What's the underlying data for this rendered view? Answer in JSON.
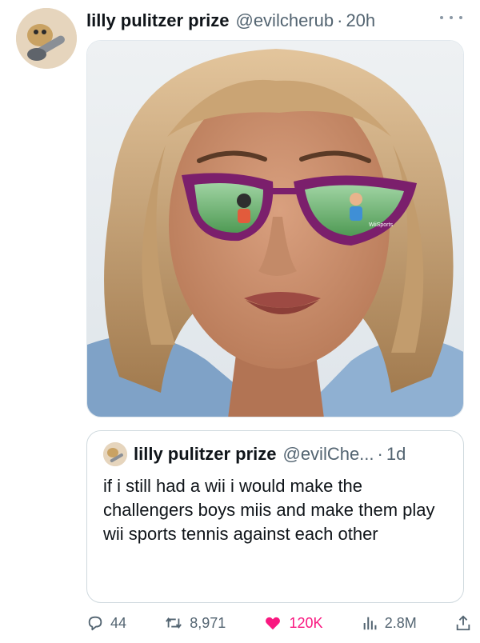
{
  "tweet": {
    "display_name": "lilly pulitzer prize",
    "handle": "@evilcherub",
    "separator": "·",
    "time": "20h",
    "avatar_icon": "avatar-guitar-icon",
    "media_text": "WiiSports"
  },
  "quoted_tweet": {
    "display_name": "lilly pulitzer prize",
    "handle": "@evilChe...",
    "separator": "·",
    "time": "1d",
    "text": "if i still had a wii i would make the challengers boys miis and make them play wii sports tennis against each other"
  },
  "actions": {
    "replies": "44",
    "reposts": "8,971",
    "likes": "120K",
    "views": "2.8M"
  },
  "colors": {
    "like": "#f91880",
    "muted": "#536471",
    "border": "#cfd9de"
  }
}
